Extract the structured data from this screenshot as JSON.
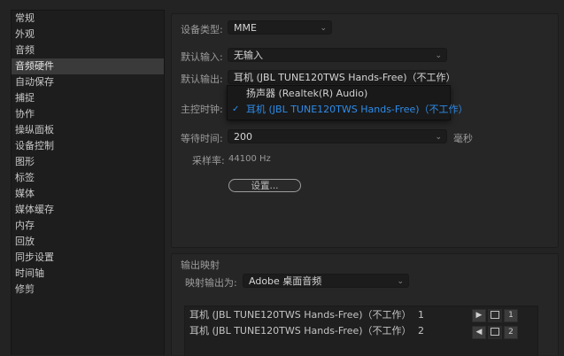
{
  "sidebar": {
    "items": [
      {
        "label": "常规"
      },
      {
        "label": "外观"
      },
      {
        "label": "音频"
      },
      {
        "label": "音频硬件",
        "selected": true
      },
      {
        "label": "自动保存"
      },
      {
        "label": "捕捉"
      },
      {
        "label": "协作"
      },
      {
        "label": "操纵面板"
      },
      {
        "label": "设备控制"
      },
      {
        "label": "图形"
      },
      {
        "label": "标签"
      },
      {
        "label": "媒体"
      },
      {
        "label": "媒体缓存"
      },
      {
        "label": "内存"
      },
      {
        "label": "回放"
      },
      {
        "label": "同步设置"
      },
      {
        "label": "时间轴"
      },
      {
        "label": "修剪"
      }
    ]
  },
  "audio_hardware": {
    "device_class_label": "设备类型:",
    "device_class_value": "MME",
    "default_input_label": "默认输入:",
    "default_input_value": "无输入",
    "default_output_label": "默认输出:",
    "default_output_value": "耳机 (JBL TUNE120TWS Hands-Free)（不工作）",
    "master_clock_label": "主控时钟:",
    "latency_label": "等待时间:",
    "latency_value": "200",
    "latency_unit": "毫秒",
    "sample_rate_label": "采样率:",
    "sample_rate_value": "44100 Hz",
    "settings_button": "设置..."
  },
  "output_dropdown": {
    "options": [
      {
        "label": "扬声器 (Realtek(R) Audio)",
        "selected": false
      },
      {
        "label": "耳机 (JBL TUNE120TWS Hands-Free)（不工作）",
        "selected": true
      }
    ],
    "selected_color": "#2d8ceb"
  },
  "output_mapping": {
    "title": "输出映射",
    "map_output_label": "映射输出为:",
    "map_output_value": "Adobe 桌面音频",
    "devices": [
      {
        "name": "耳机 (JBL TUNE120TWS Hands-Free)（不工作）",
        "channel": "1",
        "button_number": "1"
      },
      {
        "name": "耳机 (JBL TUNE120TWS Hands-Free)（不工作）",
        "channel": "2",
        "button_number": "2"
      }
    ]
  }
}
